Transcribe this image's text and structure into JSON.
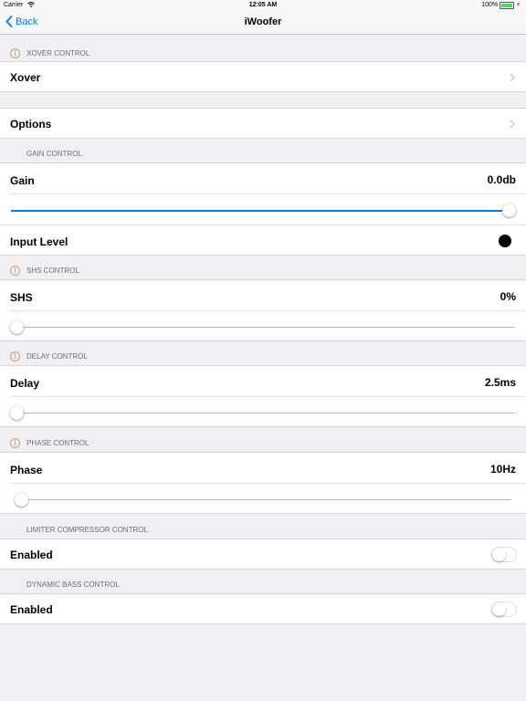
{
  "status_bar": {
    "carrier": "Carrier",
    "time": "12:05 AM",
    "battery": "100%"
  },
  "nav": {
    "back_label": "Back",
    "title": "iWoofer"
  },
  "sections": {
    "xover": {
      "header": "XOVER CONTROL",
      "row_label": "Xover"
    },
    "options": {
      "row_label": "Options"
    },
    "gain": {
      "header": "GAIN CONTROL",
      "gain_label": "Gain",
      "gain_value": "0.0db",
      "gain_slider_level": 1.0,
      "input_level_label": "Input Level"
    },
    "shs": {
      "header": "SHS CONTROL",
      "label": "SHS",
      "value": "0%",
      "slider_level": 0.0
    },
    "delay": {
      "header": "DELAY CONTROL",
      "label": "Delay",
      "value": "2.5ms",
      "slider_level": 0.0
    },
    "phase": {
      "header": "PHASE CONTROL",
      "label": "Phase",
      "value": "10Hz",
      "slider_level": 0.0
    },
    "limiter": {
      "header": "LIMITER COMPRESSOR CONTROL",
      "label": "Enabled",
      "toggle_on": false
    },
    "dynamic_bass": {
      "header": "DYNAMIC BASS CONTROL",
      "label": "Enabled",
      "toggle_on": false
    }
  },
  "colors": {
    "accent": "#007aff",
    "info_icon": "#c9a07a",
    "background": "#efeff4",
    "battery": "#4cd964"
  },
  "icons": {
    "back": "chevron-left-icon",
    "info": "info-icon",
    "disclosure": "chevron-right-icon",
    "wifi": "wifi-icon",
    "battery": "battery-icon"
  }
}
